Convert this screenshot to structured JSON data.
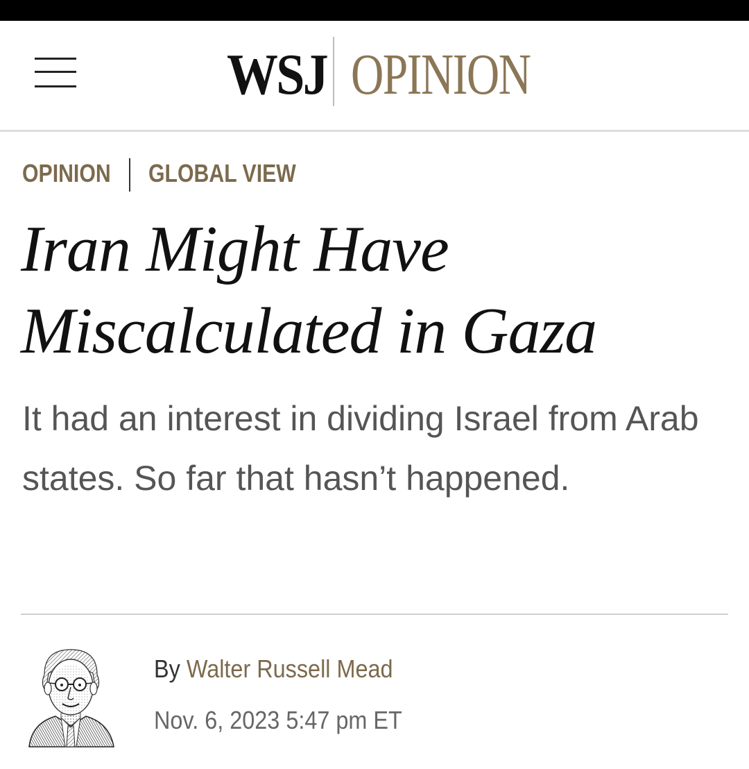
{
  "masthead": {
    "logo_primary": "WSJ",
    "logo_secondary": "OPINION",
    "accent_color": "#8b7656",
    "menu_icon": "hamburger-menu-icon"
  },
  "section_nav": {
    "items": [
      {
        "label": "OPINION"
      },
      {
        "label": "GLOBAL VIEW"
      }
    ]
  },
  "article": {
    "headline": "Iran Might Have Miscalculated in Gaza",
    "dek": "It had an interest in dividing Israel from Arab states. So far that hasn’t happened.",
    "byline_prefix": "By",
    "author": "Walter Russell Mead",
    "timestamp": "Nov. 6, 2023 5:47 pm ET",
    "author_avatar_icon": "author-portrait-icon"
  }
}
